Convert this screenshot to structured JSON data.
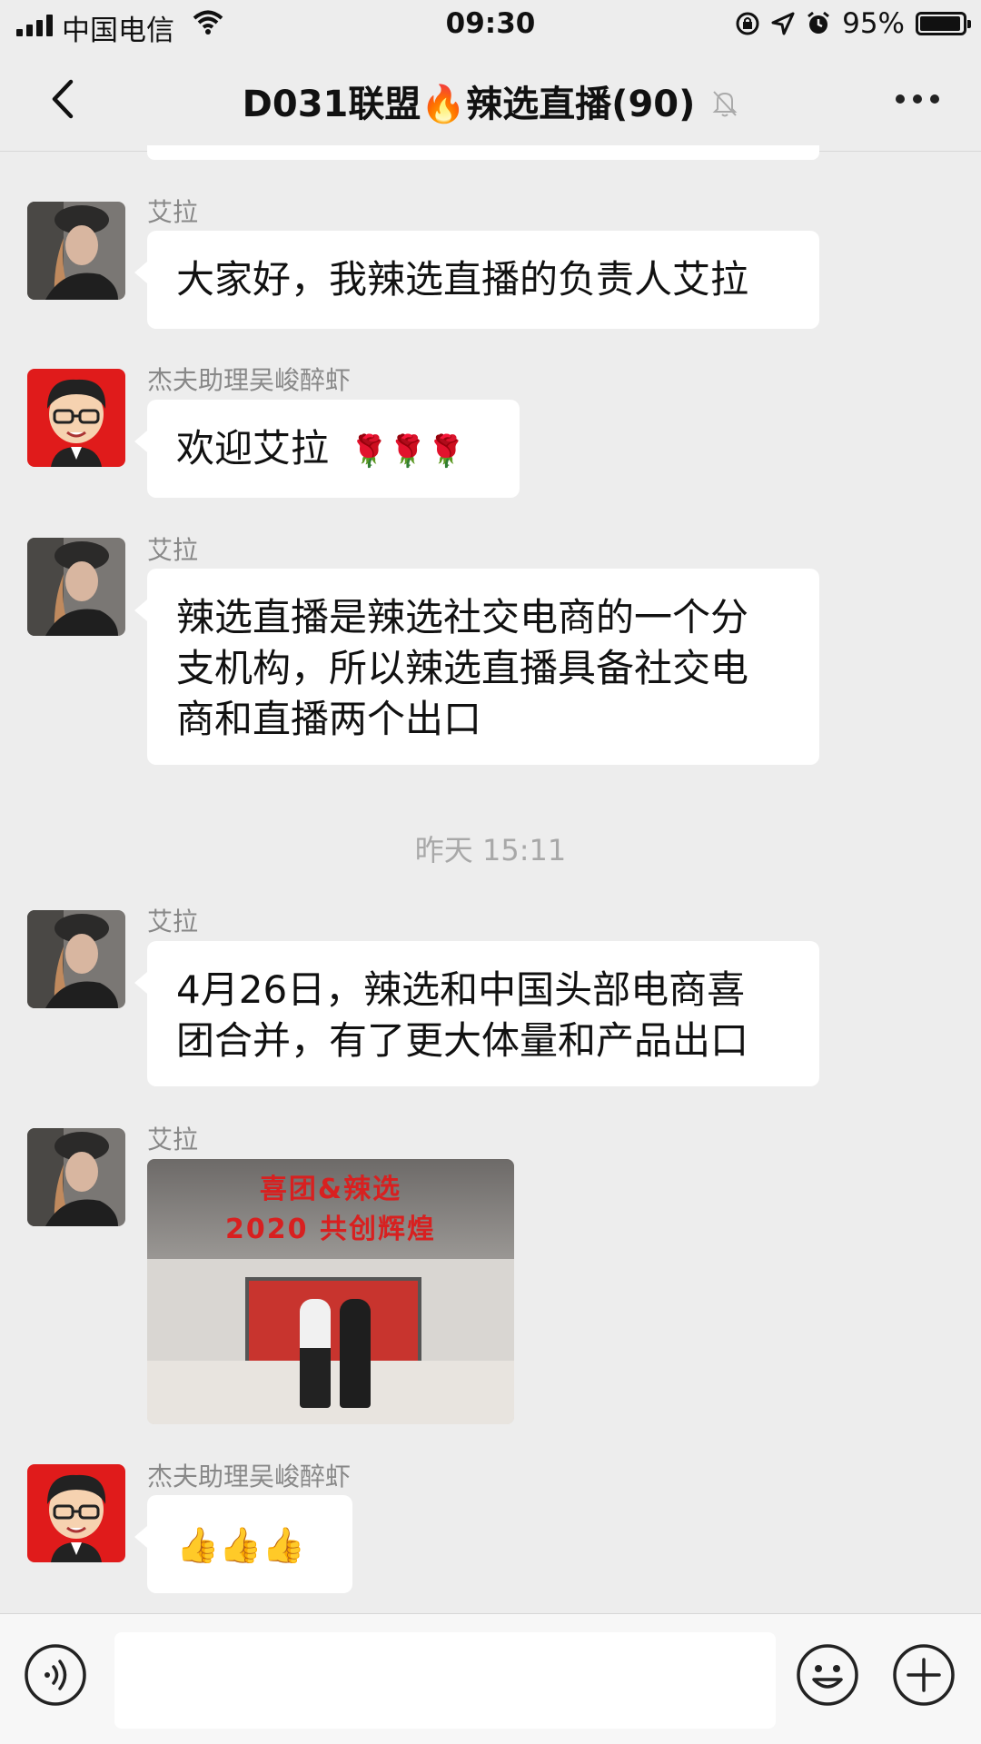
{
  "status_bar": {
    "carrier": "中国电信",
    "time": "09:30",
    "battery_percent": "95%",
    "battery_level": 0.95
  },
  "nav": {
    "title_prefix": "D031联盟",
    "title_suffix": "辣选直播(90)",
    "fire_emoji": "🔥"
  },
  "messages": [
    {
      "sender": "艾拉",
      "text_lines": [
        "大家好，我辣选直播的负责人艾拉"
      ]
    },
    {
      "sender": "杰夫助理吴峻醉虾",
      "text": "欢迎艾拉",
      "emoji": "🌹🌹🌹"
    },
    {
      "sender": "艾拉",
      "text_lines": [
        "辣选直播是辣选社交电商的一个分",
        "支机构，所以辣选直播具备社交电",
        "商和直播两个出口"
      ]
    },
    {
      "sender": "艾拉",
      "text_lines": [
        "4月26日，辣选和中国头部电商喜",
        "团合并，有了更大体量和产品出口"
      ]
    },
    {
      "sender": "艾拉",
      "image_text_1": "喜团&辣选",
      "image_text_2": "2020 共创辉煌"
    },
    {
      "sender": "杰夫助理吴峻醉虾",
      "emoji": "👍👍👍"
    }
  ],
  "timestamp": "昨天 15:11",
  "input": {
    "placeholder": ""
  },
  "icons": {
    "back": "chevron-left-icon",
    "mute": "bell-off-icon",
    "more": "more-dots-icon",
    "voice": "voice-icon",
    "emoji": "smiley-icon",
    "plus": "plus-circle-icon"
  }
}
